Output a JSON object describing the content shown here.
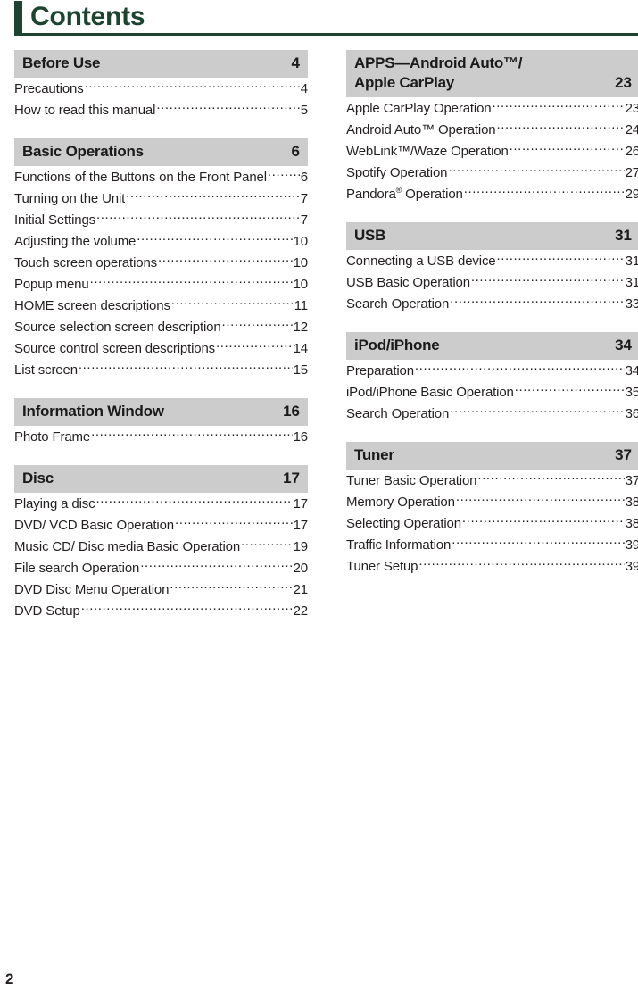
{
  "header": {
    "title": "Contents",
    "accent_color": "#1d4430"
  },
  "footer": {
    "page_number": "2"
  },
  "section_bar_color": "#cccccc",
  "columns": [
    {
      "name": "left",
      "sections": [
        {
          "title": "Before Use",
          "page": "4",
          "entries": [
            {
              "title": "Precautions",
              "page": "4"
            },
            {
              "title": "How to read this manual",
              "page": "5"
            }
          ]
        },
        {
          "title": "Basic Operations",
          "page": "6",
          "entries": [
            {
              "title": "Functions of the Buttons on the Front Panel",
              "page": "6"
            },
            {
              "title": "Turning on the Unit",
              "page": "7"
            },
            {
              "title": "Initial Settings",
              "page": "7"
            },
            {
              "title": "Adjusting the volume",
              "page": "10"
            },
            {
              "title": "Touch screen operations",
              "page": "10"
            },
            {
              "title": "Popup menu",
              "page": "10"
            },
            {
              "title": "HOME screen descriptions",
              "page": "11"
            },
            {
              "title": "Source selection screen description",
              "page": "12"
            },
            {
              "title": "Source control screen descriptions",
              "page": "14"
            },
            {
              "title": "List screen",
              "page": "15"
            }
          ]
        },
        {
          "title": "Information Window",
          "page": "16",
          "entries": [
            {
              "title": "Photo Frame",
              "page": "16"
            }
          ]
        },
        {
          "title": "Disc",
          "page": "17",
          "entries": [
            {
              "title": "Playing a disc",
              "page": "17"
            },
            {
              "title": "DVD/ VCD Basic Operation",
              "page": "17"
            },
            {
              "title": "Music CD/ Disc media Basic Operation",
              "page": "19"
            },
            {
              "title": "File search Operation",
              "page": "20"
            },
            {
              "title": "DVD Disc Menu Operation",
              "page": "21"
            },
            {
              "title": "DVD Setup",
              "page": "22"
            }
          ]
        }
      ]
    },
    {
      "name": "right",
      "sections": [
        {
          "title": "APPS—Android Auto™/\nApple CarPlay",
          "page": "23",
          "entries": [
            {
              "title": "Apple CarPlay Operation",
              "page": "23"
            },
            {
              "title": "Android Auto™ Operation",
              "page": "24"
            },
            {
              "title": "WebLink™/Waze Operation",
              "page": "26"
            },
            {
              "title": "Spotify Operation",
              "page": "27"
            },
            {
              "title": "Pandora® Operation",
              "page": "29"
            }
          ]
        },
        {
          "title": "USB",
          "page": "31",
          "entries": [
            {
              "title": "Connecting a USB device",
              "page": "31"
            },
            {
              "title": "USB Basic Operation",
              "page": "31"
            },
            {
              "title": "Search Operation",
              "page": "33"
            }
          ]
        },
        {
          "title": "iPod/iPhone",
          "page": "34",
          "entries": [
            {
              "title": "Preparation",
              "page": "34"
            },
            {
              "title": "iPod/iPhone Basic Operation",
              "page": "35"
            },
            {
              "title": "Search Operation",
              "page": "36"
            }
          ]
        },
        {
          "title": "Tuner",
          "page": "37",
          "entries": [
            {
              "title": "Tuner Basic Operation",
              "page": "37"
            },
            {
              "title": "Memory Operation",
              "page": "38"
            },
            {
              "title": "Selecting Operation",
              "page": "38"
            },
            {
              "title": "Traffic Information",
              "page": "39"
            },
            {
              "title": "Tuner Setup",
              "page": "39"
            }
          ]
        }
      ]
    }
  ]
}
